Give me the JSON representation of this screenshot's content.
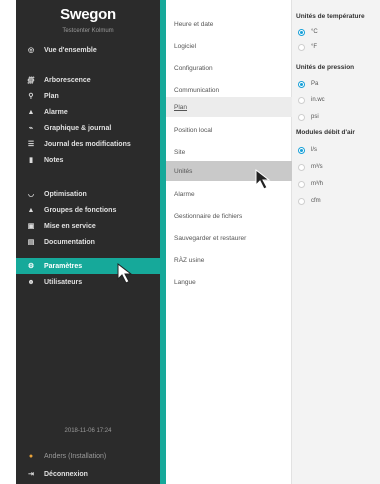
{
  "sidebar": {
    "brand": "Swegon",
    "subtitle": "Testcenter Kolmum",
    "top_items": [
      {
        "label": "Vue d'ensemble",
        "icon": "eye-icon"
      }
    ],
    "items": [
      {
        "label": "Arborescence",
        "icon": "tree-icon"
      },
      {
        "label": "Plan",
        "icon": "location-pin-icon"
      },
      {
        "label": "Alarme",
        "icon": "bell-icon"
      },
      {
        "label": "Graphique & journal",
        "icon": "chart-icon"
      },
      {
        "label": "Journal des modifications",
        "icon": "list-icon"
      },
      {
        "label": "Notes",
        "icon": "note-icon"
      }
    ],
    "tools": [
      {
        "label": "Optimisation",
        "icon": "gauge-icon"
      },
      {
        "label": "Groupes de fonctions",
        "icon": "groups-icon"
      },
      {
        "label": "Mise en service",
        "icon": "commissioning-icon"
      },
      {
        "label": "Documentation",
        "icon": "document-icon"
      },
      {
        "label": "Paramètres",
        "icon": "gear-icon"
      },
      {
        "label": "Utilisateurs",
        "icon": "users-icon"
      }
    ],
    "timestamp": "2018-11-06 17:24",
    "user": "Anders (Installation)",
    "logout": "Déconnexion"
  },
  "menu": {
    "items": [
      "Heure et date",
      "Logiciel",
      "Configuration",
      "Communication",
      "Plan",
      "Position local",
      "Site",
      "Unités",
      "Alarme",
      "Gestionnaire de fichiers",
      "Sauvegarder et restaurer",
      "RÀZ usine",
      "Langue"
    ],
    "selected": "Unités",
    "hovered": "Plan"
  },
  "units": {
    "temperature": {
      "title": "Unités de température",
      "options": [
        "°C",
        "°F"
      ],
      "selected": "°C"
    },
    "pressure": {
      "title": "Unités de pression",
      "options": [
        "Pa",
        "in.wc",
        "psi"
      ],
      "selected": "Pa"
    },
    "airflow": {
      "title": "Modules débit d'air",
      "options": [
        "l/s",
        "m³/s",
        "m³/h",
        "cfm"
      ],
      "selected": "l/s"
    }
  },
  "colors": {
    "sidebar_bg": "#2b2b2b",
    "accent_teal": "#16a99a",
    "radio_blue": "#18a0d8",
    "right_bg": "#f3f3f3",
    "selected_row": "#c9c9c9"
  }
}
